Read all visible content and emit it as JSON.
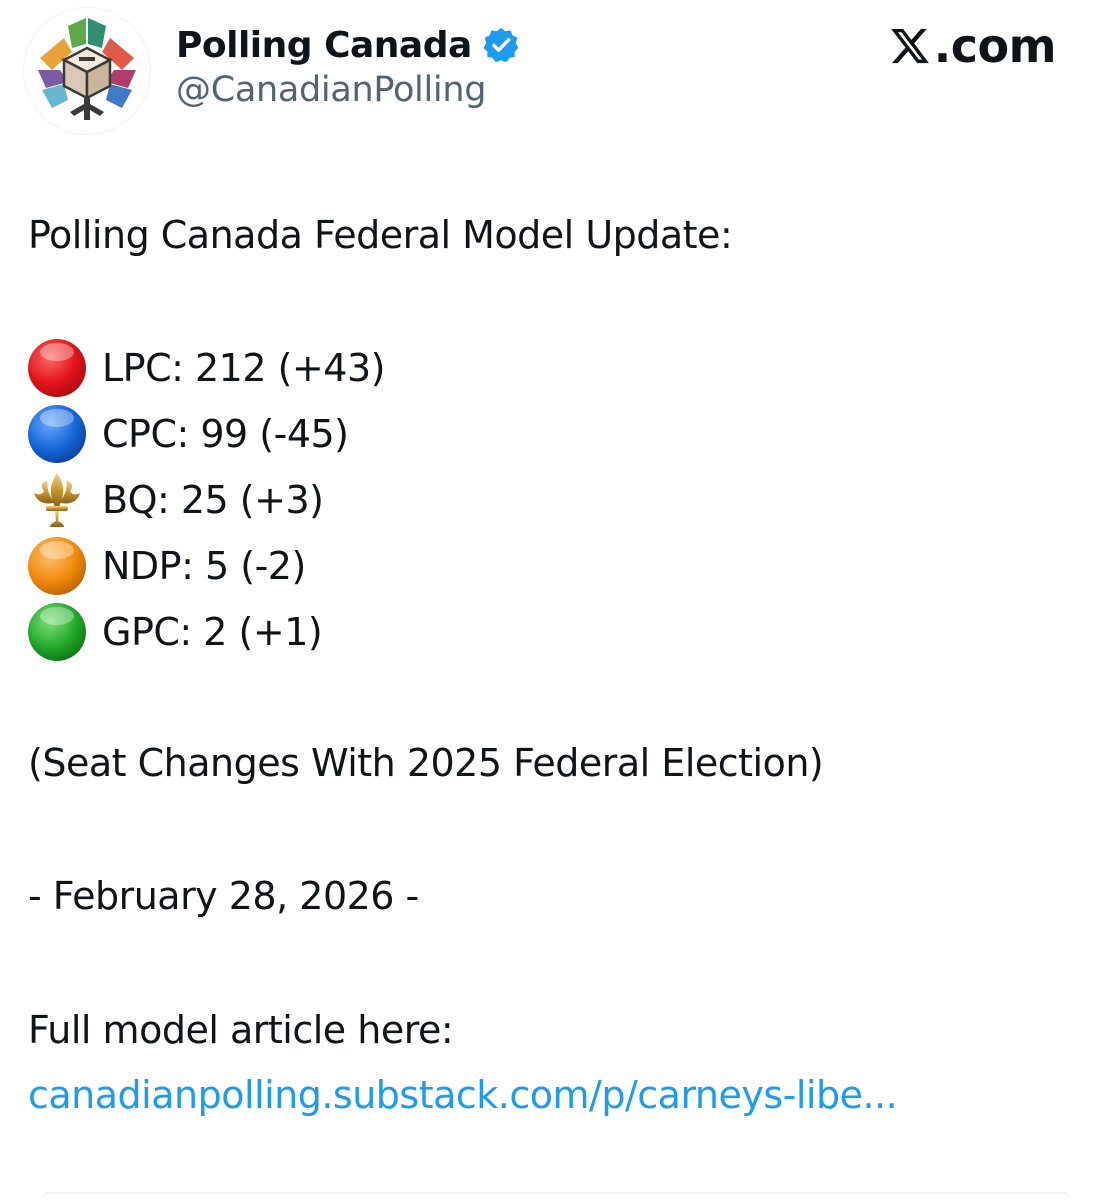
{
  "author": {
    "display_name": "Polling Canada",
    "handle": "@CanadianPolling",
    "verified": true,
    "avatar_icon": "polling-canada-logo-icon"
  },
  "brand": {
    "label": ".com",
    "icon": "x-logo-icon"
  },
  "post": {
    "headline": "Polling Canada Federal Model Update:",
    "parties": [
      {
        "label": "LPC: 212 (+43)",
        "marker": "red-circle-icon",
        "color": "#e0121a"
      },
      {
        "label": "CPC: 99 (-45)",
        "marker": "blue-circle-icon",
        "color": "#1565d8"
      },
      {
        "label": "BQ: 25 (+3)",
        "marker": "fleur-de-lis-icon",
        "color": "#c8962e"
      },
      {
        "label": "NDP: 5 (-2)",
        "marker": "orange-circle-icon",
        "color": "#f08a0c"
      },
      {
        "label": "GPC: 2 (+1)",
        "marker": "green-circle-icon",
        "color": "#22a82a"
      }
    ],
    "note": "(Seat Changes With 2025 Federal Election)",
    "date_line": "- February 28, 2026 -",
    "article_label": "Full model article here:",
    "article_link": "canadianpolling.substack.com/p/carneys-libe..."
  },
  "colors": {
    "text": "#0f1419",
    "secondary": "#536471",
    "link": "#1d9bf0",
    "verified": "#1d9bf0"
  }
}
